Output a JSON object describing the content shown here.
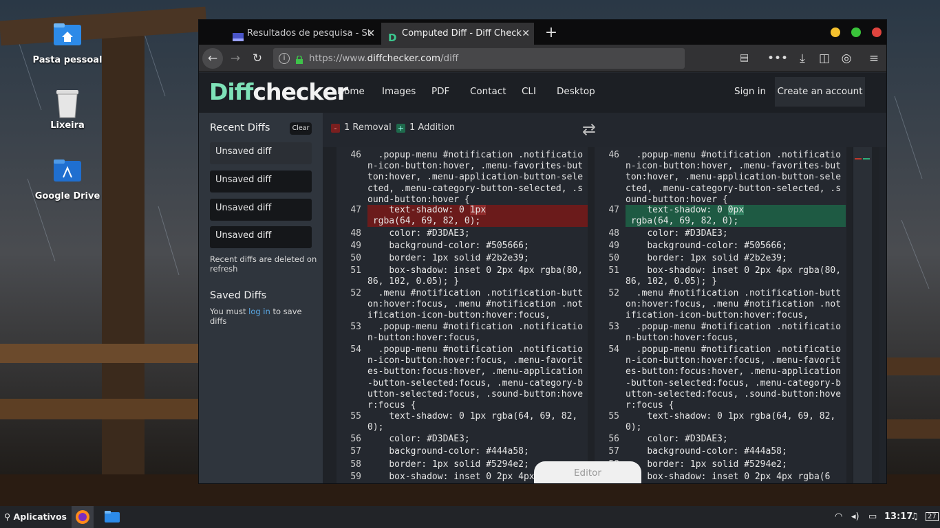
{
  "desktop": {
    "icons": [
      {
        "label": "Pasta pessoal",
        "icon": "home-folder-icon"
      },
      {
        "label": "Lixeira",
        "icon": "trash-icon"
      },
      {
        "label": "Google Drive",
        "icon": "google-drive-folder-icon"
      }
    ]
  },
  "browser": {
    "tabs": [
      {
        "title": "Resultados de pesquisa - St",
        "icon": "search-results-favicon",
        "active": false
      },
      {
        "title": "Computed Diff - Diff Check",
        "icon": "diffchecker-favicon",
        "active": true
      }
    ],
    "url_prefix": "https://www.",
    "url_domain": "diffchecker.com",
    "url_path": "/diff",
    "window_buttons": {
      "minimize": "#f5c12e",
      "maximize": "#3ac43a",
      "close": "#e0443e"
    }
  },
  "site": {
    "logo_main": "Diff",
    "logo_rest": "checker",
    "nav": [
      "Home",
      "Images",
      "PDF",
      "Contact",
      "CLI",
      "Desktop"
    ],
    "sign_in": "Sign in",
    "create_account": "Create an account",
    "sidebar": {
      "recent_title": "Recent Diffs",
      "clear": "Clear",
      "recent_items": [
        "Unsaved diff",
        "Unsaved diff",
        "Unsaved diff",
        "Unsaved diff"
      ],
      "recent_note": "Recent diffs are deleted on refresh",
      "saved_title": "Saved Diffs",
      "saved_pre": "You must ",
      "saved_link": "log in",
      "saved_post": " to save diffs"
    },
    "summary": {
      "removal_chip": "-",
      "removal": "1 Removal",
      "addition_chip": "+",
      "addition": "1 Addition"
    },
    "editor_tab": "Editor",
    "left_lines": [
      {
        "num": "46",
        "text": "  .popup-menu #notification .notification-icon-button:hover, .menu-favorites-button:hover, .menu-application-button-selected, .menu-category-button-selected, .sound-button:hover {",
        "type": "normal"
      },
      {
        "num": "47",
        "pre": "    text-shadow: 0 ",
        "hl": "1px",
        "post": "\n rgba(64, 69, 82, 0);",
        "type": "rem"
      },
      {
        "num": "48",
        "text": "    color: #D3DAE3;",
        "type": "normal"
      },
      {
        "num": "49",
        "text": "    background-color: #505666;",
        "type": "normal"
      },
      {
        "num": "50",
        "text": "    border: 1px solid #2b2e39;",
        "type": "normal"
      },
      {
        "num": "51",
        "text": "    box-shadow: inset 0 2px 4px rgba(80, 86, 102, 0.05); }",
        "type": "normal"
      },
      {
        "num": "52",
        "text": "  .menu #notification .notification-button:hover:focus, .menu #notification .notification-icon-button:hover:focus,",
        "type": "normal"
      },
      {
        "num": "53",
        "text": "  .popup-menu #notification .notification-button:hover:focus,",
        "type": "normal"
      },
      {
        "num": "54",
        "text": "  .popup-menu #notification .notification-icon-button:hover:focus, .menu-favorites-button:focus:hover, .menu-application-button-selected:focus, .menu-category-button-selected:focus, .sound-button:hover:focus {",
        "type": "normal"
      },
      {
        "num": "55",
        "text": "    text-shadow: 0 1px rgba(64, 69, 82, 0);",
        "type": "normal"
      },
      {
        "num": "56",
        "text": "    color: #D3DAE3;",
        "type": "normal"
      },
      {
        "num": "57",
        "text": "    background-color: #444a58;",
        "type": "normal"
      },
      {
        "num": "58",
        "text": "    border: 1px solid #5294e2;",
        "type": "normal"
      },
      {
        "num": "59",
        "text": "    box-shadow: inset 0 2px 4px",
        "type": "normal"
      }
    ],
    "right_lines": [
      {
        "num": "46",
        "text": "  .popup-menu #notification .notification-icon-button:hover, .menu-favorites-button:hover, .menu-application-button-selected, .menu-category-button-selected, .sound-button:hover {",
        "type": "normal"
      },
      {
        "num": "47",
        "pre": "    text-shadow: 0 ",
        "hl": "0px",
        "post": "\n rgba(64, 69, 82, 0);",
        "type": "add"
      },
      {
        "num": "48",
        "text": "    color: #D3DAE3;",
        "type": "normal"
      },
      {
        "num": "49",
        "text": "    background-color: #505666;",
        "type": "normal"
      },
      {
        "num": "50",
        "text": "    border: 1px solid #2b2e39;",
        "type": "normal"
      },
      {
        "num": "51",
        "text": "    box-shadow: inset 0 2px 4px rgba(80, 86, 102, 0.05); }",
        "type": "normal"
      },
      {
        "num": "52",
        "text": "  .menu #notification .notification-button:hover:focus, .menu #notification .notification-icon-button:hover:focus,",
        "type": "normal"
      },
      {
        "num": "53",
        "text": "  .popup-menu #notification .notification-button:hover:focus,",
        "type": "normal"
      },
      {
        "num": "54",
        "text": "  .popup-menu #notification .notification-icon-button:hover:focus, .menu-favorites-button:focus:hover, .menu-application-button-selected:focus, .menu-category-button-selected:focus, .sound-button:hover:focus {",
        "type": "normal"
      },
      {
        "num": "55",
        "text": "    text-shadow: 0 1px rgba(64, 69, 82, 0);",
        "type": "normal"
      },
      {
        "num": "56",
        "text": "    color: #D3DAE3;",
        "type": "normal"
      },
      {
        "num": "57",
        "text": "    background-color: #444a58;",
        "type": "normal"
      },
      {
        "num": "58",
        "text": "    border: 1px solid #5294e2;",
        "type": "normal"
      },
      {
        "num": "59",
        "text": "    box-shadow: inset 0 2px 4px rgba(6",
        "type": "normal"
      }
    ]
  },
  "taskbar": {
    "menu_label": "Aplicativos",
    "clock": "13:17",
    "calendar_day": "27"
  }
}
